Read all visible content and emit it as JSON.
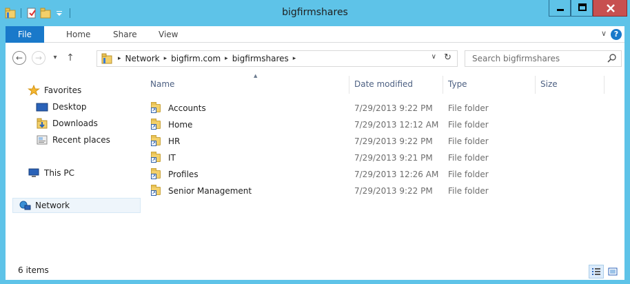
{
  "window": {
    "title": "bigfirmshares",
    "minimize_label": "–",
    "maximize_label": "□",
    "close_label": "x"
  },
  "ribbon": {
    "tabs": [
      "File",
      "Home",
      "Share",
      "View"
    ],
    "expand_label": "∨",
    "help_label": "?"
  },
  "nav": {
    "back": "←",
    "forward": "→",
    "recent": "▾",
    "up": "↑"
  },
  "address": {
    "crumbs": [
      "Network",
      "bigfirm.com",
      "bigfirmshares"
    ],
    "separator": "▸",
    "dropdown": "∨",
    "refresh": "↻"
  },
  "search": {
    "placeholder": "Search bigfirmshares"
  },
  "sidebar": {
    "items": [
      {
        "label": "Favorites",
        "icon": "star-icon"
      },
      {
        "label": "Desktop",
        "icon": "desktop-icon"
      },
      {
        "label": "Downloads",
        "icon": "downloads-icon"
      },
      {
        "label": "Recent places",
        "icon": "recent-places-icon"
      },
      {
        "label": "This PC",
        "icon": "computer-icon"
      },
      {
        "label": "Network",
        "icon": "network-icon"
      }
    ]
  },
  "columns": {
    "name": "Name",
    "date": "Date modified",
    "type": "Type",
    "size": "Size"
  },
  "files": [
    {
      "name": "Accounts",
      "date": "7/29/2013 9:22 PM",
      "type": "File folder"
    },
    {
      "name": "Home",
      "date": "7/29/2013 12:12 AM",
      "type": "File folder"
    },
    {
      "name": "HR",
      "date": "7/29/2013 9:22 PM",
      "type": "File folder"
    },
    {
      "name": "IT",
      "date": "7/29/2013 9:21 PM",
      "type": "File folder"
    },
    {
      "name": "Profiles",
      "date": "7/29/2013 12:26 AM",
      "type": "File folder"
    },
    {
      "name": "Senior Management",
      "date": "7/29/2013 9:22 PM",
      "type": "File folder"
    }
  ],
  "status": {
    "item_count": "6 items"
  },
  "colors": {
    "titlebar": "#5ec3e8",
    "file_tab": "#1979ca",
    "close_button": "#c75050"
  }
}
